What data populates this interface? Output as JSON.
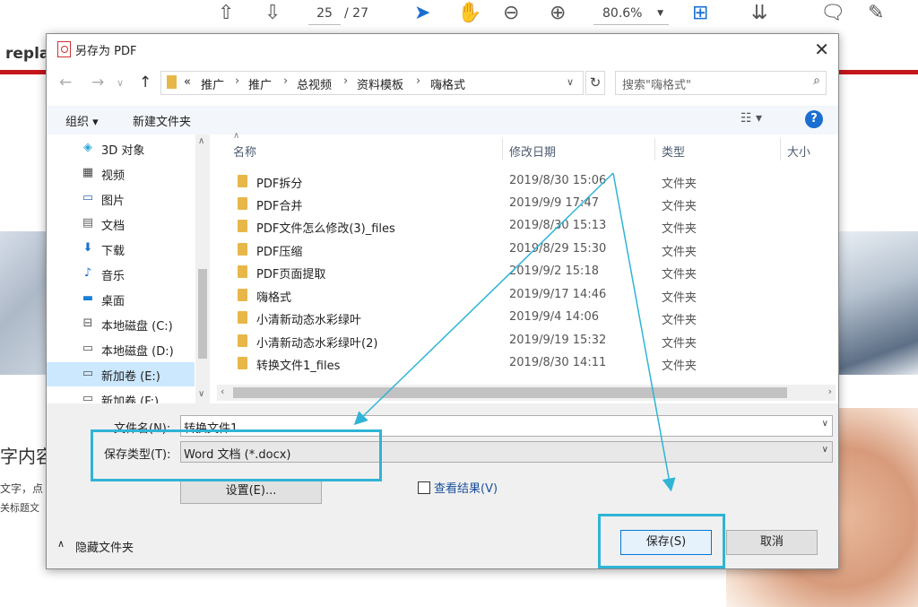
{
  "background_app": {
    "page_current": "25",
    "page_total": "/ 27",
    "zoom": "80.6%",
    "left_heading": "repla",
    "side_text1": "字内容",
    "side_text2": "文字，点",
    "side_text3": "关标题文"
  },
  "dialog": {
    "title": "另存为 PDF",
    "breadcrumb": [
      "推广",
      "推广",
      "总视频",
      "资料模板",
      "嗨格式"
    ],
    "breadcrumb_prefix": "«",
    "search_placeholder": "搜索\"嗨格式\"",
    "toolbar": {
      "organize": "组织 ▾",
      "new_folder": "新建文件夹",
      "help": "?"
    },
    "nav": [
      {
        "label": "3D 对象",
        "icon": "3d-objects-icon"
      },
      {
        "label": "视频",
        "icon": "video-icon"
      },
      {
        "label": "图片",
        "icon": "pictures-icon"
      },
      {
        "label": "文档",
        "icon": "documents-icon"
      },
      {
        "label": "下载",
        "icon": "download-icon"
      },
      {
        "label": "音乐",
        "icon": "music-icon"
      },
      {
        "label": "桌面",
        "icon": "desktop-icon"
      },
      {
        "label": "本地磁盘 (C:)",
        "icon": "drive-icon"
      },
      {
        "label": "本地磁盘 (D:)",
        "icon": "drive-icon"
      },
      {
        "label": "新加卷 (E:)",
        "icon": "drive-icon",
        "selected": true
      },
      {
        "label": "新加卷 (F:)",
        "icon": "drive-icon"
      }
    ],
    "columns": {
      "name": "名称",
      "date": "修改日期",
      "type": "类型",
      "size": "大小"
    },
    "files": [
      {
        "name": "PDF拆分",
        "date": "2019/8/30 15:06",
        "type": "文件夹"
      },
      {
        "name": "PDF合并",
        "date": "2019/9/9 17:47",
        "type": "文件夹"
      },
      {
        "name": "PDF文件怎么修改(3)_files",
        "date": "2019/8/30 15:13",
        "type": "文件夹"
      },
      {
        "name": "PDF压缩",
        "date": "2019/8/29 15:30",
        "type": "文件夹"
      },
      {
        "name": "PDF页面提取",
        "date": "2019/9/2 15:18",
        "type": "文件夹"
      },
      {
        "name": "嗨格式",
        "date": "2019/9/17 14:46",
        "type": "文件夹"
      },
      {
        "name": "小清新动态水彩绿叶",
        "date": "2019/9/4 14:06",
        "type": "文件夹"
      },
      {
        "name": "小清新动态水彩绿叶(2)",
        "date": "2019/9/19 15:32",
        "type": "文件夹"
      },
      {
        "name": "转换文件1_files",
        "date": "2019/8/30 14:11",
        "type": "文件夹"
      }
    ],
    "filename_label": "文件名(N):",
    "filename_value": "转换文件1",
    "filetype_label": "保存类型(T):",
    "filetype_value": "Word 文档 (*.docx)",
    "settings_button": "设置(E)...",
    "view_result_label": "查看结果(V)",
    "hide_folders": "隐藏文件夹",
    "save_button": "保存(S)",
    "cancel_button": "取消"
  },
  "colors": {
    "highlight": "#2fb4d6",
    "accent_red": "#c4161c",
    "folder": "#e8b74a",
    "selection": "#cce8ff"
  }
}
